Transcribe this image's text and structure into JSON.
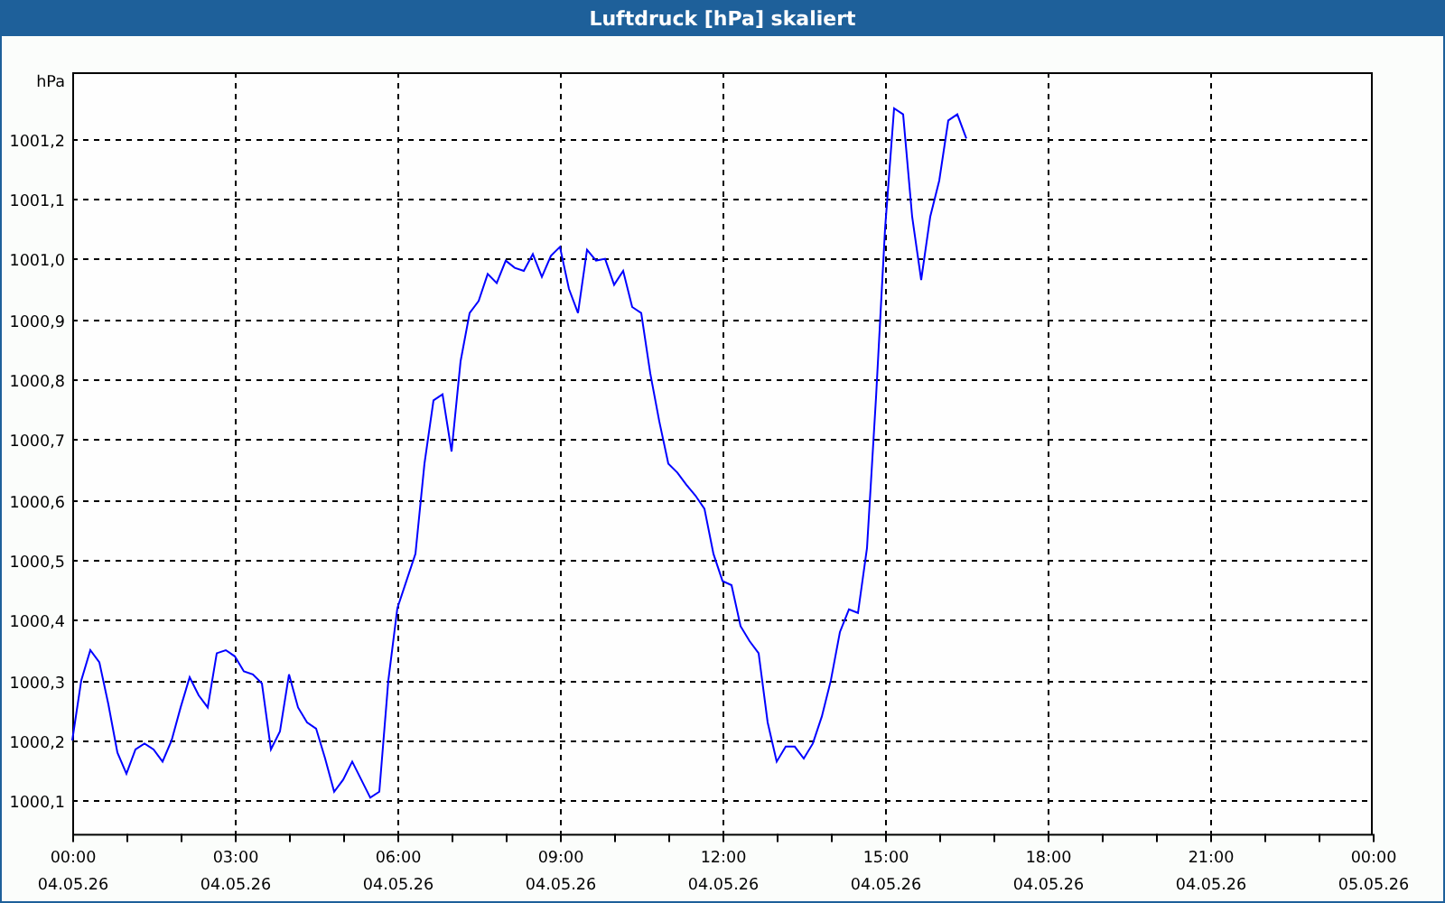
{
  "chart": {
    "chart_data": {
      "type": "line",
      "title": "Luftdruck [hPa] skaliert",
      "ylabel": "hPa",
      "categories": [
        "00:00\n04.05.26",
        null,
        null,
        null,
        null,
        null,
        null,
        null,
        null,
        null,
        null,
        null,
        null,
        null,
        null,
        null,
        null,
        null,
        "03:00\n04.05.26",
        null,
        null,
        null,
        null,
        null,
        null,
        null,
        null,
        null,
        null,
        null,
        null,
        null,
        null,
        null,
        null,
        null,
        "06:00\n04.05.26",
        null,
        null,
        null,
        null,
        null,
        null,
        null,
        null,
        null,
        null,
        null,
        null,
        null,
        null,
        null,
        null,
        null,
        "09:00\n04.05.26",
        null,
        null,
        null,
        null,
        null,
        null,
        null,
        null,
        null,
        null,
        null,
        null,
        null,
        null,
        null,
        null,
        null,
        "12:00\n04.05.26",
        null,
        null,
        null,
        null,
        null,
        null,
        null,
        null,
        null,
        null,
        null,
        null,
        null,
        null,
        null,
        null,
        null,
        "15:00\n04.05.26",
        null,
        null,
        null,
        null,
        null,
        null,
        null,
        null,
        null,
        null,
        null,
        null,
        null,
        null,
        null,
        null,
        null,
        "18:00\n04.05.26",
        null,
        null,
        null,
        null,
        null,
        null,
        null,
        null,
        null,
        null,
        null,
        null,
        null,
        null,
        null,
        null,
        null,
        "21:00\n04.05.26",
        null,
        null,
        null,
        null,
        null,
        null,
        null,
        null,
        null,
        null,
        null,
        null,
        null,
        null,
        null,
        null,
        null,
        "00:00\n05.05.26"
      ],
      "series": [
        {
          "color": "#0000ff",
          "values": [
            1000.2,
            1000.3,
            1000.35,
            1000.33,
            1000.26,
            1000.18,
            1000.145,
            1000.185,
            1000.195,
            1000.185,
            1000.165,
            1000.2,
            1000.255,
            1000.305,
            1000.275,
            1000.255,
            1000.345,
            1000.35,
            1000.34,
            1000.315,
            1000.31,
            1000.295,
            1000.185,
            1000.215,
            1000.31,
            1000.255,
            1000.23,
            1000.22,
            1000.17,
            1000.115,
            1000.135,
            1000.165,
            1000.135,
            1000.105,
            1000.115,
            1000.3,
            1000.42,
            1000.465,
            1000.51,
            1000.66,
            1000.765,
            1000.775,
            1000.68,
            1000.83,
            1000.91,
            1000.93,
            1000.975,
            1000.96,
            1000.997,
            1000.985,
            1000.98,
            1001.008,
            1000.97,
            1001.005,
            1001.02,
            1000.95,
            1000.91,
            1001.015,
            1000.997,
            1001.0,
            1000.957,
            1000.98,
            1000.92,
            1000.91,
            1000.81,
            1000.73,
            1000.66,
            1000.645,
            1000.625,
            1000.607,
            1000.585,
            1000.51,
            1000.465,
            1000.458,
            1000.39,
            1000.365,
            1000.345,
            1000.23,
            1000.165,
            1000.19,
            1000.19,
            1000.17,
            1000.195,
            1000.24,
            1000.3,
            1000.38,
            1000.418,
            1000.412,
            1000.52,
            1000.77,
            1001.05,
            1001.25,
            1001.24,
            1001.07,
            1000.965,
            1001.07,
            1001.13,
            1001.23,
            1001.24,
            1001.2,
            null,
            null,
            null,
            null,
            null,
            null,
            null,
            null,
            null,
            null,
            null,
            null,
            null,
            null,
            null,
            null,
            null,
            null,
            null,
            null,
            null,
            null,
            null,
            null,
            null,
            null,
            null,
            null,
            null,
            null,
            null,
            null,
            null,
            null,
            null,
            null,
            null,
            null,
            null,
            null,
            null,
            null,
            null,
            null,
            null
          ]
        }
      ],
      "grid": true,
      "ylim": [
        1000.045,
        1001.31
      ],
      "yticks": [
        {
          "value": 1000.1,
          "label": "1000,1"
        },
        {
          "value": 1000.2,
          "label": "1000,2"
        },
        {
          "value": 1000.3,
          "label": "1000,3"
        },
        {
          "value": 1000.4,
          "label": "1000,4"
        },
        {
          "value": 1000.5,
          "label": "1000,5"
        },
        {
          "value": 1000.6,
          "label": "1000,6"
        },
        {
          "value": 1000.7,
          "label": "1000,7"
        },
        {
          "value": 1000.8,
          "label": "1000,8"
        },
        {
          "value": 1000.9,
          "label": "1000,9"
        },
        {
          "value": 1001.0,
          "label": "1001,0"
        },
        {
          "value": 1001.1,
          "label": "1001,1"
        },
        {
          "value": 1001.2,
          "label": "1001,2"
        }
      ]
    }
  }
}
